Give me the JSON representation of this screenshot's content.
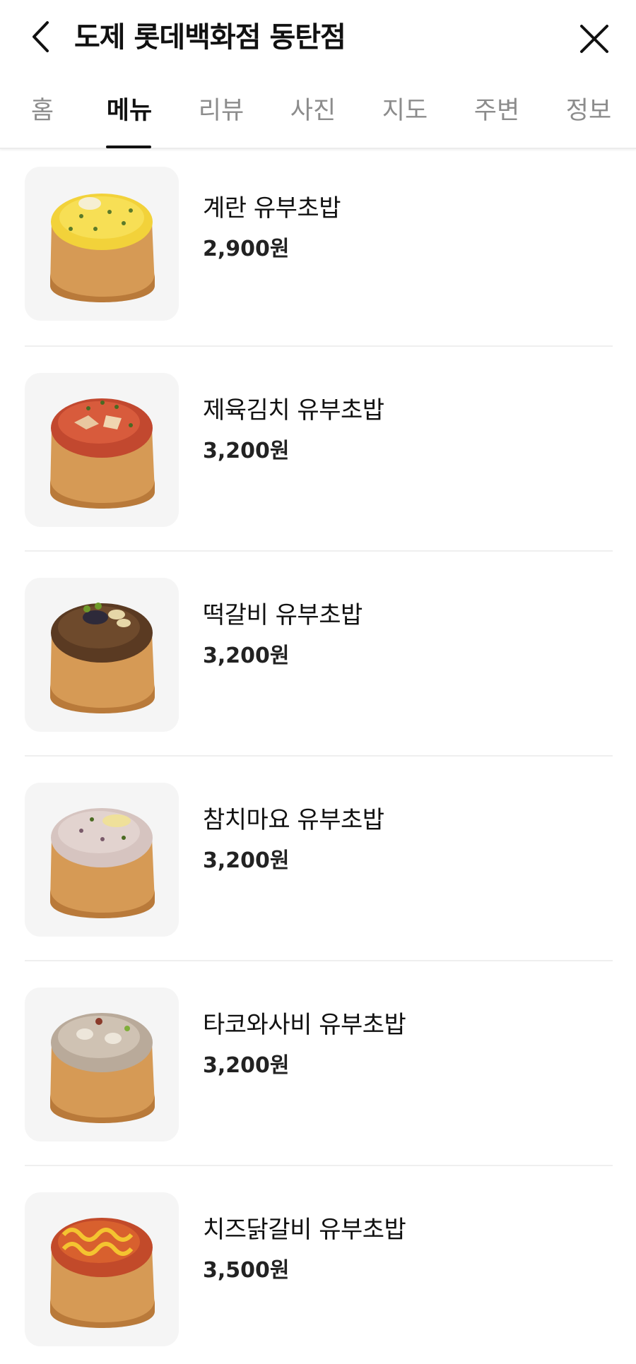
{
  "header": {
    "title": "도제 롯데백화점 동탄점",
    "back_icon": "chevron-left-icon",
    "close_icon": "close-icon"
  },
  "tabs": [
    {
      "label": "홈",
      "active": false
    },
    {
      "label": "메뉴",
      "active": true
    },
    {
      "label": "리뷰",
      "active": false
    },
    {
      "label": "사진",
      "active": false
    },
    {
      "label": "지도",
      "active": false
    },
    {
      "label": "주변",
      "active": false
    },
    {
      "label": "정보",
      "active": false
    }
  ],
  "menu": {
    "items": [
      {
        "name": "계란 유부초밥",
        "price": "2,900원",
        "topping": "egg"
      },
      {
        "name": "제육김치 유부초밥",
        "price": "3,200원",
        "topping": "pork-kimchi"
      },
      {
        "name": "떡갈비 유부초밥",
        "price": "3,200원",
        "topping": "tteokgalbi"
      },
      {
        "name": "참치마요 유부초밥",
        "price": "3,200원",
        "topping": "tuna-mayo"
      },
      {
        "name": "타코와사비 유부초밥",
        "price": "3,200원",
        "topping": "tako-wasabi"
      },
      {
        "name": "치즈닭갈비 유부초밥",
        "price": "3,500원",
        "topping": "cheese-dakgalbi"
      }
    ]
  },
  "colors": {
    "active_tab": "#111111",
    "inactive_tab": "#8c8c8c",
    "thumb_bg": "#f5f5f5",
    "divider": "#efefef",
    "tofu_skin": "#d69a55"
  }
}
